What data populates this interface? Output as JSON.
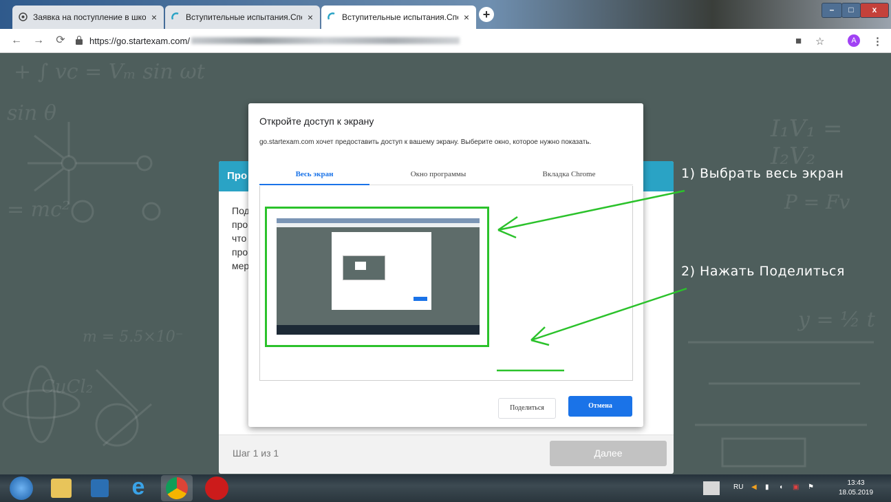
{
  "browser": {
    "tabs": [
      {
        "label": "Заявка на поступление в школу",
        "close": "×",
        "active": false
      },
      {
        "label": "Вступительные испытания.Спец",
        "close": "×",
        "active": false
      },
      {
        "label": "Вступительные испытания.Спец",
        "close": "×",
        "active": true
      }
    ],
    "new_tab": "+",
    "window_controls": {
      "minimize": "–",
      "maximize": "□",
      "close": "x"
    },
    "url": "https://go.startexam.com/",
    "profile_initial": "A",
    "icons": [
      "back-icon",
      "forward-icon",
      "reload-icon",
      "lock-icon",
      "camera-icon",
      "star-icon",
      "menu-icon"
    ]
  },
  "card": {
    "header": "Про",
    "body_lines": [
      "Под",
      "про",
      "что",
      "про",
      "мер"
    ],
    "step": "Шаг 1 из 1",
    "next_label": "Далее"
  },
  "dialog": {
    "title": "Откройте доступ к экрану",
    "description": "go.startexam.com хочет предоставить доступ к вашему экрану. Выберите окно, которое нужно показать.",
    "tabs": [
      "Весь экран",
      "Окно программы",
      "Вкладка Chrome"
    ],
    "selected_tab": 0,
    "share_label": "Поделиться",
    "cancel_label": "Отмена"
  },
  "annotations": {
    "step1": "1) Выбрать весь экран",
    "step2": "2) Нажать Поделиться",
    "color": "#2bc22b"
  },
  "taskbar": {
    "language": "RU",
    "time": "13:43",
    "date": "18.05.2019"
  },
  "colors": {
    "accent": "#1a73e8",
    "card_header": "#2aa3c5",
    "highlight": "#2bc22b",
    "background": "#4e5e5c"
  }
}
